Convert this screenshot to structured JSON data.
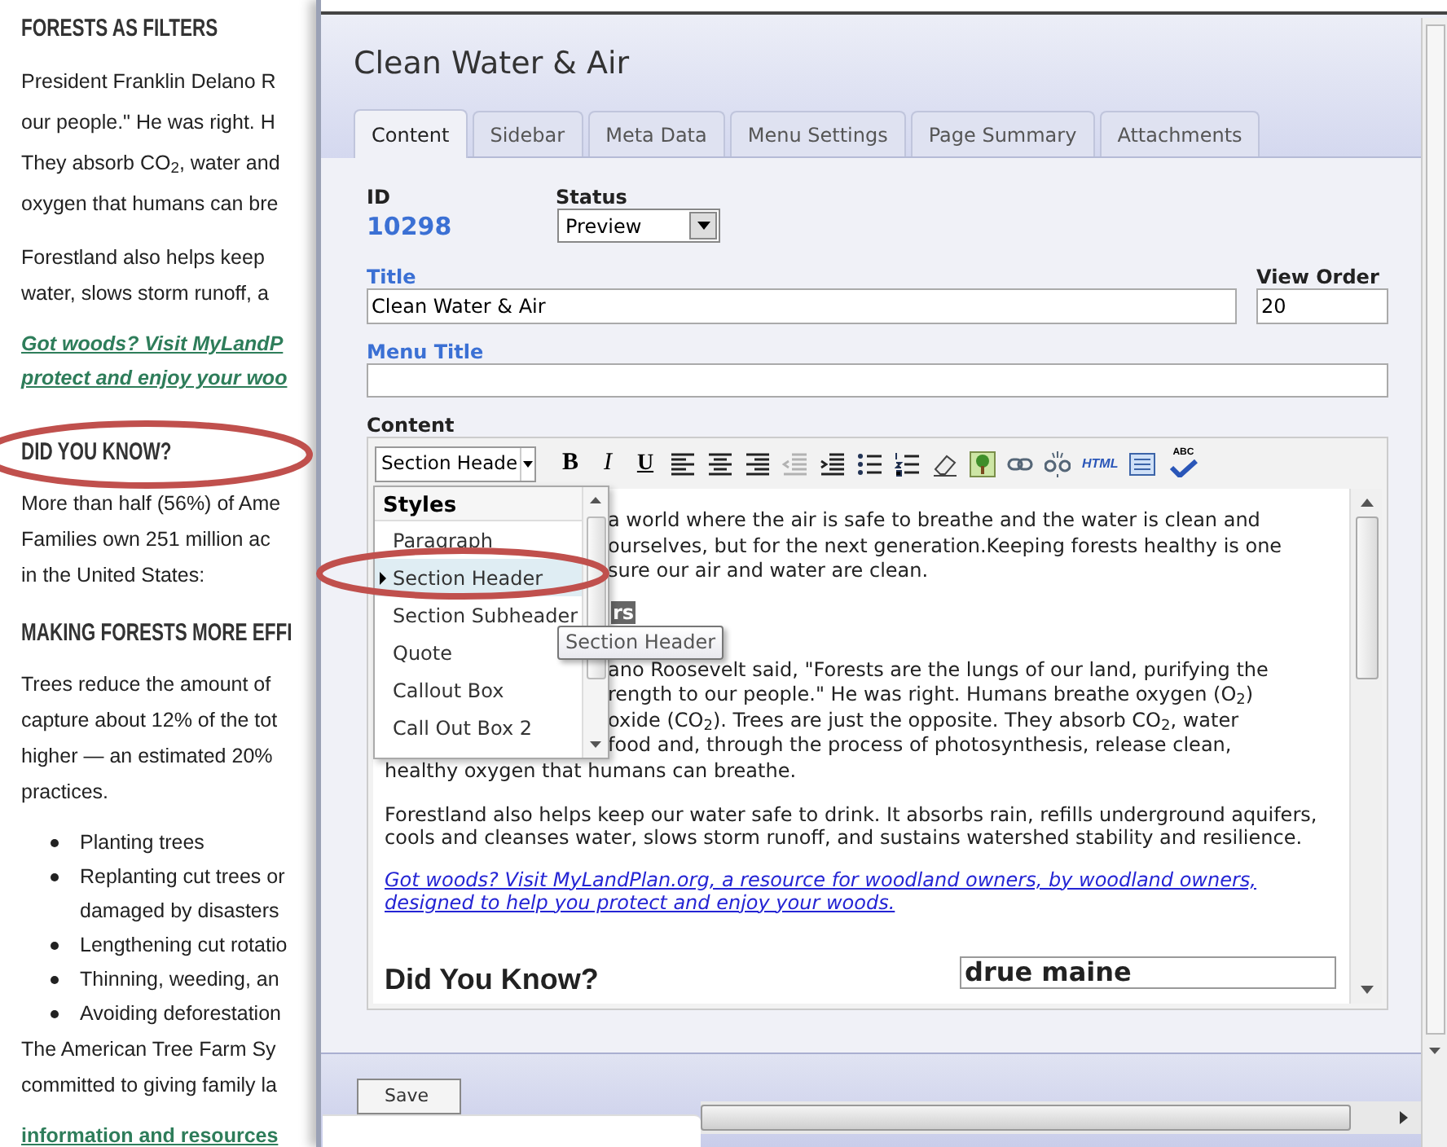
{
  "background_page": [
    {
      "kind": "heading",
      "lines": [
        "FORESTS AS FILTERS"
      ]
    },
    {
      "kind": "paragraph",
      "lines": [
        "President Franklin Delano R",
        "our people.\" He was right. H",
        "They absorb CO$_{2}$, water and",
        "oxygen that humans can bre"
      ]
    },
    {
      "kind": "paragraph_tight",
      "lines": [
        "Forestland also helps keep",
        "water, slows storm runoff, a"
      ]
    },
    {
      "kind": "link",
      "italic": true,
      "lines": [
        "Got woods? Visit MyLandP",
        "protect and enjoy your woo"
      ]
    },
    {
      "kind": "heading",
      "lines": [
        "DID YOU KNOW?"
      ]
    },
    {
      "kind": "paragraph_tight",
      "lines": [
        "More than half (56%) of Ame",
        "Families own 251 million ac",
        "in the United States:"
      ]
    },
    {
      "kind": "heading",
      "lines": [
        "MAKING FORESTS MORE EFFI"
      ]
    },
    {
      "kind": "paragraph_tight",
      "lines": [
        "Trees reduce the amount of",
        "capture about 12% of the tot",
        "higher — an estimated 20%",
        "practices."
      ]
    },
    {
      "kind": "bullets",
      "items": [
        [
          "Planting trees"
        ],
        [
          "Replanting cut trees or",
          "damaged by disasters"
        ],
        [
          "Lengthening cut rotatio"
        ],
        [
          "Thinning, weeding, an"
        ],
        [
          "Avoiding deforestation"
        ]
      ]
    },
    {
      "kind": "paragraph_tight",
      "lines": [
        "The American Tree Farm Sy",
        "committed to giving family la"
      ]
    },
    {
      "kind": "link",
      "italic": false,
      "lines": [
        "information and resources"
      ]
    }
  ],
  "window": {
    "title": "Clean Water & Air"
  },
  "tabs": [
    {
      "label": "Content",
      "selected": true
    },
    {
      "label": "Sidebar",
      "selected": false
    },
    {
      "label": "Meta Data",
      "selected": false
    },
    {
      "label": "Menu Settings",
      "selected": false
    },
    {
      "label": "Page Summary",
      "selected": false
    },
    {
      "label": "Attachments",
      "selected": false
    }
  ],
  "form": {
    "id_label": "ID",
    "id_value": "10298",
    "status_label": "Status",
    "status_value": "Preview",
    "title_label": "Title",
    "title_value": "Clean Water & Air",
    "view_order_label": "View Order",
    "view_order_value": "20",
    "menu_title_label": "Menu Title",
    "content_label": "Content"
  },
  "editor": {
    "style_select": "Section Heade",
    "toolbar": [
      {
        "kind": "bold",
        "label": "B"
      },
      {
        "kind": "italic",
        "label": "I"
      },
      {
        "kind": "underline",
        "label": "U"
      },
      {
        "kind": "align_left"
      },
      {
        "kind": "align_center"
      },
      {
        "kind": "align_right"
      },
      {
        "kind": "outdent",
        "disabled": true
      },
      {
        "kind": "indent",
        "disabled": false
      },
      {
        "kind": "bullets"
      },
      {
        "kind": "numbers"
      },
      {
        "kind": "eraser"
      },
      {
        "kind": "image"
      },
      {
        "kind": "link"
      },
      {
        "kind": "unlink"
      },
      {
        "kind": "html",
        "label": "HTML"
      },
      {
        "kind": "source"
      },
      {
        "kind": "spellcheck",
        "label": "ABC"
      }
    ],
    "content": [
      {
        "kind": "clipped",
        "text": "a world where the air is safe to breathe and the water is clean and"
      },
      {
        "kind": "clipped",
        "text": "ourselves, but for the next generation.Keeping forests healthy is one"
      },
      {
        "kind": "clipped",
        "text": "sure our air and water are clean."
      },
      {
        "kind": "heading_fragment",
        "text": "rs"
      },
      {
        "kind": "clipped",
        "text": "ano Roosevelt said, \"Forests are the lungs of our land, purifying the"
      },
      {
        "kind": "clipped",
        "text": "rength to our people.\" He was right. Humans breathe oxygen (O$_{2}$)"
      },
      {
        "kind": "clipped",
        "text": "oxide (CO$_{2}$). Trees are just the opposite. They absorb CO$_{2}$, water"
      },
      {
        "kind": "clipped",
        "text": "food and, through the process of photosynthesis, release clean,"
      },
      {
        "kind": "line",
        "text": "healthy oxygen that humans can breathe."
      },
      {
        "kind": "paragraph",
        "text": "Forestland also helps keep our water safe to drink. It absorbs rain, refills underground aquifers, cools and cleanses water, slows storm runoff, and sustains watershed stability and resilience."
      },
      {
        "kind": "link",
        "text": "Got woods? Visit MyLandPlan.org, a resource for woodland owners, by woodland owners, designed to help you protect and enjoy your woods."
      },
      {
        "kind": "heading",
        "text": "Did You Know?",
        "box": "drue maine"
      }
    ],
    "styles_menu": {
      "title": "Styles",
      "items": [
        {
          "label": "Paragraph",
          "selected": false
        },
        {
          "label": "Section Header",
          "selected": true
        },
        {
          "label": "Section Subheader",
          "selected": false
        },
        {
          "label": "Quote",
          "selected": false
        },
        {
          "label": "Callout Box",
          "selected": false
        },
        {
          "label": "Call Out Box 2",
          "selected": false
        }
      ]
    },
    "tooltip": "Section Header"
  },
  "footer": {
    "save_button": "Save"
  }
}
